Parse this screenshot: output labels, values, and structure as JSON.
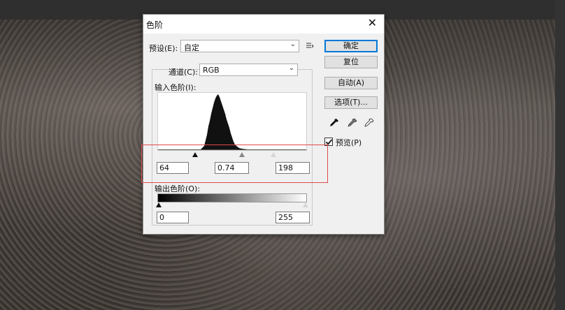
{
  "dialog": {
    "title": "色阶",
    "close_glyph": "✕",
    "preset_label": "预设(E):",
    "preset_value": "自定",
    "channel_label": "通道(C):",
    "channel_value": "RGB",
    "input_levels_label": "输入色阶(I):",
    "input_black": "64",
    "input_gamma": "0.74",
    "input_white": "198",
    "output_levels_label": "输出色阶(O):",
    "output_black": "0",
    "output_white": "255",
    "preview_label": "预览(P)",
    "preview_checked": true
  },
  "buttons": {
    "ok": "确定",
    "reset": "复位",
    "auto": "自动(A)",
    "options": "选项(T)..."
  },
  "icons": {
    "preset_menu": "preset-options-icon",
    "eyedroppers": [
      "black-eyedropper-icon",
      "gray-eyedropper-icon",
      "white-eyedropper-icon"
    ]
  },
  "highlight_color": "#e24b4b"
}
